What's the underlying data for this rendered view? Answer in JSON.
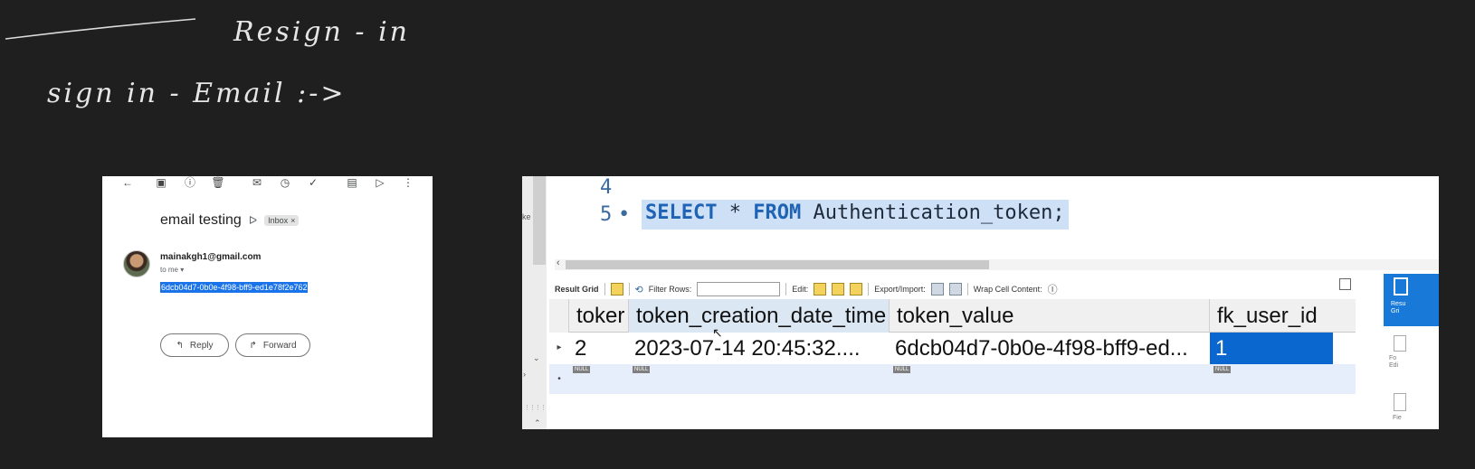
{
  "whiteboard": {
    "line1": "Resign - in",
    "line2": "sign in - Email :->"
  },
  "gmail": {
    "subject": "email testing",
    "label": "Inbox",
    "label_close": "×",
    "sender": "mainakgh1@gmail.com",
    "to": "to me",
    "body_token": "6dcb04d7-0b0e-4f98-bff9-ed1e78f2e762",
    "reply": "Reply",
    "forward": "Forward"
  },
  "workbench": {
    "line4_no": "4",
    "line5_no": "5",
    "line5_bullet": "•",
    "sql_kw1": "SELECT",
    "sql_star": "*",
    "sql_kw2": "FROM",
    "sql_table": "Authentication_token;",
    "gutter_text": "ke",
    "toolbar": {
      "result_grid": "Result Grid",
      "filter_rows": "Filter Rows:",
      "edit": "Edit:",
      "export_import": "Export/Import:",
      "wrap": "Wrap Cell Content:"
    },
    "side_tabs": {
      "result_grid_1": "Resu",
      "result_grid_2": "Gri",
      "form_editor_1": "Fo",
      "form_editor_2": "Edi",
      "field": "Fie"
    },
    "grid": {
      "columns": [
        "toker",
        "token_creation_date_time",
        "token_value",
        "fk_user_id"
      ],
      "rows": [
        [
          "2",
          "2023-07-14 20:45:32....",
          "6dcb04d7-0b0e-4f98-bff9-ed...",
          "1"
        ]
      ],
      "null_badge": "NULL"
    }
  }
}
